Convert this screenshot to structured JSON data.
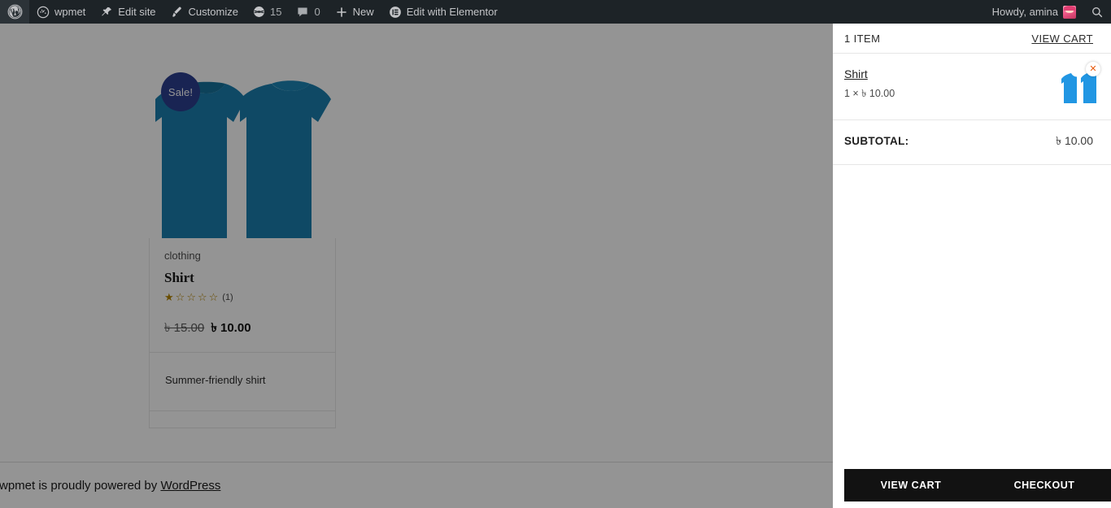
{
  "adminbar": {
    "left_items": [
      {
        "id": "wp-logo",
        "icon": "wordpress-icon",
        "label": ""
      },
      {
        "id": "site-name",
        "icon": "dashboard-icon",
        "label": "wpmet"
      },
      {
        "id": "edit-site",
        "icon": "pin-icon",
        "label": "Edit site"
      },
      {
        "id": "customize",
        "icon": "brush-icon",
        "label": "Customize"
      },
      {
        "id": "updates",
        "icon": "updates-icon",
        "label": "15"
      },
      {
        "id": "comments",
        "icon": "comment-icon",
        "label": "0"
      },
      {
        "id": "new",
        "icon": "plus-icon",
        "label": "New"
      },
      {
        "id": "elementor",
        "icon": "elementor-icon",
        "label": "Edit with Elementor"
      }
    ],
    "greeting": "Howdy, amina",
    "avatar_alt": "avatar",
    "search_icon": "search-icon"
  },
  "product": {
    "sale_badge": "Sale!",
    "category": "clothing",
    "title": "Shirt",
    "rating_stars_filled": 1,
    "rating_stars_total": 5,
    "rating_count": "(1)",
    "price_old": "৳ 15.00",
    "price_new": "৳ 10.00",
    "description": "Summer-friendly shirt",
    "image_alt": "blue-tshirt-front-and-back"
  },
  "footer": {
    "credit_prefix": "wpmet is proudly powered by ",
    "credit_link": "WordPress"
  },
  "side_cart": {
    "item_count_label": "1 ITEM",
    "view_cart_link": "VIEW CART",
    "items": [
      {
        "name": "Shirt",
        "qty_price": "1 × ৳ 10.00",
        "remove_icon": "close-icon",
        "thumb_alt": "shirt-thumbnail"
      }
    ],
    "subtotal_label": "SUBTOTAL:",
    "subtotal_value": "৳ 10.00",
    "buttons": {
      "view_cart": "VIEW CART",
      "checkout": "CHECKOUT"
    }
  },
  "colors": {
    "adminbar_bg": "#1d2327",
    "shirt_blue": "#1a7fae",
    "sale_badge_bg": "#2c3e8f",
    "cart_action_bg": "#121212",
    "star_gold": "#b58500",
    "remove_orange": "#e8590c",
    "overlay": "rgba(0,0,0,0.42)"
  }
}
